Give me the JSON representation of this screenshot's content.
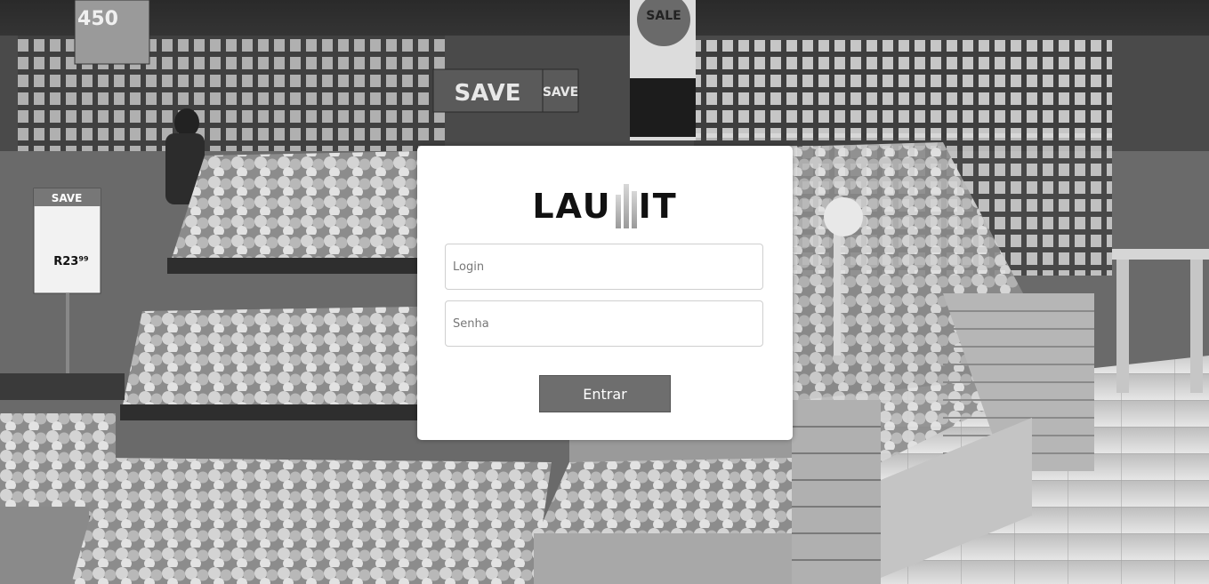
{
  "background": {
    "signs": {
      "save_large": "SAVE",
      "save_small": "SAVE",
      "price_tag_header": "SAVE",
      "price_tag_value": "R23⁹⁹",
      "promo_450": "450",
      "sale": "SALE"
    }
  },
  "login_card": {
    "logo": {
      "left_text": "LAU",
      "right_text": "IT"
    },
    "login_field": {
      "placeholder": "Login",
      "value": ""
    },
    "senha_field": {
      "placeholder": "Senha",
      "value": ""
    },
    "submit_label": "Entrar"
  }
}
